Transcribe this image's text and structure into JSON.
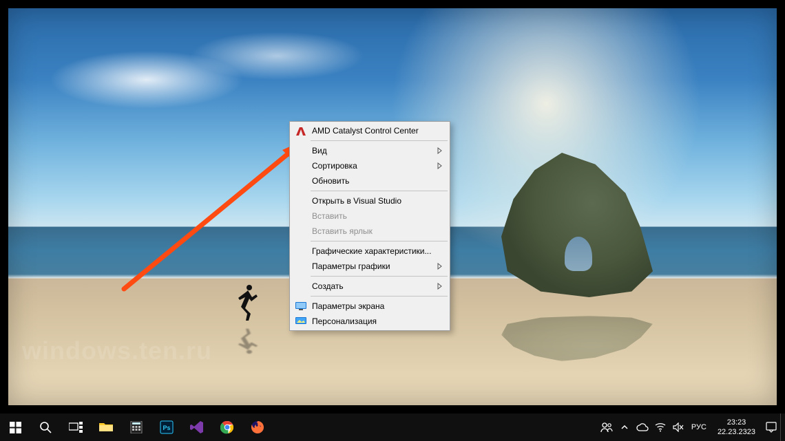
{
  "watermark": "windows.ten.ru",
  "context_menu": {
    "amd": "AMD Catalyst Control Center",
    "view": "Вид",
    "sort": "Сортировка",
    "refresh": "Обновить",
    "open_vs": "Открыть в Visual Studio",
    "paste": "Вставить",
    "paste_shortcut": "Вставить ярлык",
    "gfx_props": "Графические характеристики...",
    "gfx_params": "Параметры графики",
    "create": "Создать",
    "display_settings": "Параметры экрана",
    "personalize": "Персонализация"
  },
  "tray": {
    "language": "РУС",
    "time": "23:23",
    "date": "22.23.2323"
  }
}
